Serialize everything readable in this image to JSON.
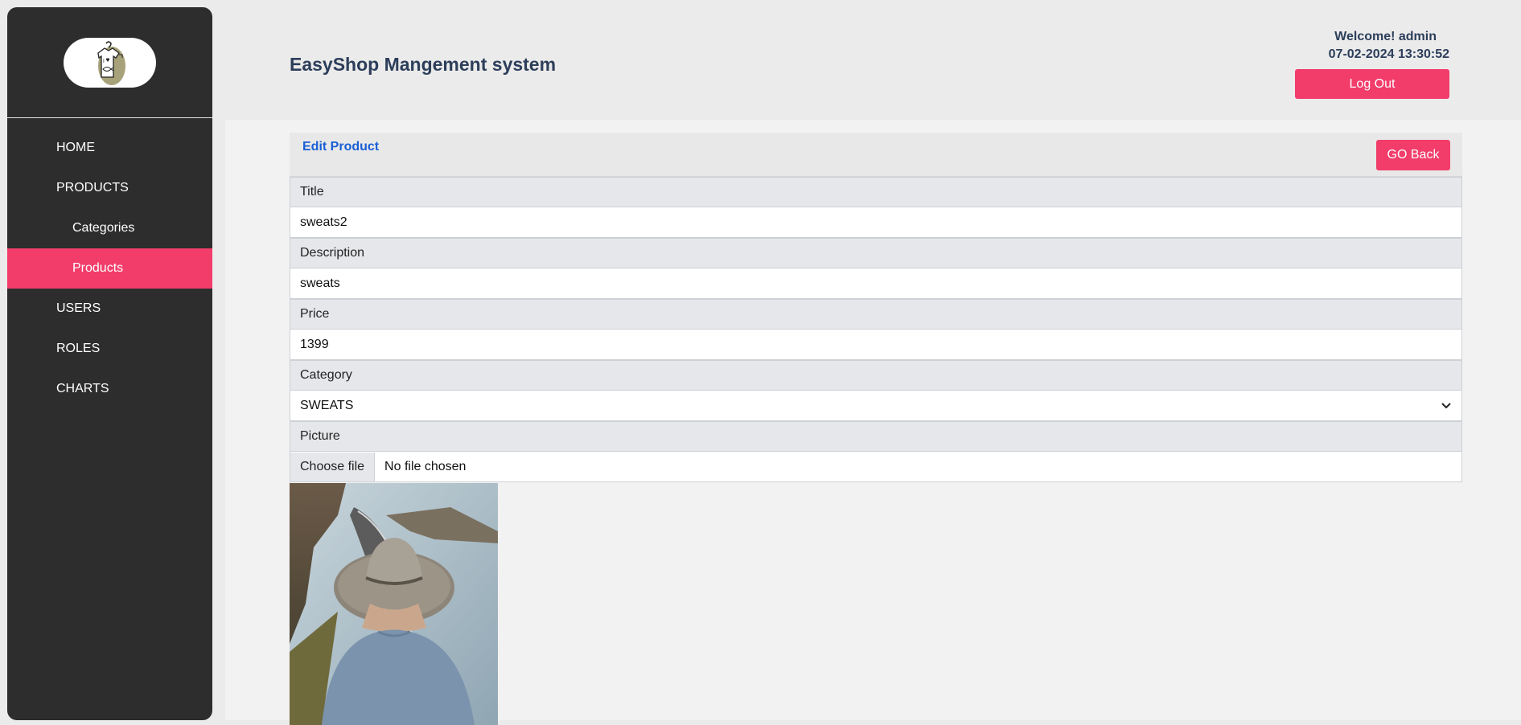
{
  "sidebar": {
    "logo": {
      "icon": "shirt-logo-icon"
    },
    "items": [
      {
        "label": "HOME"
      },
      {
        "label": "PRODUCTS"
      },
      {
        "label": "Categories"
      },
      {
        "label": "Products"
      },
      {
        "label": "USERS"
      },
      {
        "label": "ROLES"
      },
      {
        "label": "CHARTS"
      }
    ],
    "active_index": 3
  },
  "header": {
    "title": "EasyShop Mangement system",
    "welcome": "Welcome! admin",
    "datetime": "07-02-2024 13:30:52",
    "logout_label": "Log Out"
  },
  "form": {
    "heading": "Edit Product",
    "goback_label": "GO Back",
    "title_label": "Title",
    "title_value": "sweats2",
    "description_label": "Description",
    "description_value": "sweats",
    "price_label": "Price",
    "price_value": "1399",
    "category_label": "Category",
    "category_value": "SWEATS",
    "picture_label": "Picture",
    "file_button_label": "Choose file",
    "file_status": "No file chosen"
  },
  "colors": {
    "accent": "#f23d6b",
    "sidebar": "#2d2d2d",
    "heading_link": "#1a5fd6",
    "title_text": "#2c3e5a"
  }
}
